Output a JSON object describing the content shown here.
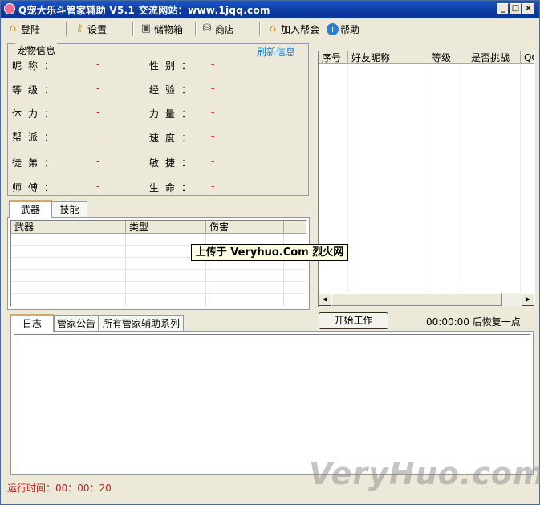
{
  "window": {
    "title": "Q宠大乐斗管家辅助 V5.1 交流网站：www.1jqq.com",
    "controls": [
      "_",
      "□",
      "×"
    ]
  },
  "toolbar": {
    "items": [
      {
        "label": "登陆",
        "icon": "house-icon"
      },
      {
        "label": "设置",
        "icon": "key-icon"
      },
      {
        "label": "储物箱",
        "icon": "box-icon"
      },
      {
        "label": "商店",
        "icon": "shop-icon"
      },
      {
        "label": "加入帮会",
        "icon": "house-icon"
      },
      {
        "label": "帮助",
        "icon": "help-icon"
      }
    ]
  },
  "pet_info": {
    "title": "宠物信息",
    "refresh_label": "刷新信息",
    "left": [
      {
        "label": "昵称：",
        "value": "-"
      },
      {
        "label": "等级：",
        "value": "-"
      },
      {
        "label": "体力：",
        "value": "-"
      },
      {
        "label": "帮派：",
        "value": "-"
      },
      {
        "label": "徒弟：",
        "value": "-"
      },
      {
        "label": "师傅：",
        "value": "-"
      }
    ],
    "right": [
      {
        "label": "性别：",
        "value": "-"
      },
      {
        "label": "经验：",
        "value": "-"
      },
      {
        "label": "力量：",
        "value": "-"
      },
      {
        "label": "速度：",
        "value": "-"
      },
      {
        "label": "敏捷：",
        "value": "-"
      },
      {
        "label": "生命：",
        "value": "-"
      }
    ]
  },
  "equip_tabs": [
    "武器",
    "技能"
  ],
  "weapon_table": {
    "columns": [
      "武器",
      "类型",
      "伤害"
    ]
  },
  "friend_table": {
    "columns": [
      "序号",
      "好友昵称",
      "等级",
      "是否挑战",
      "QQ"
    ]
  },
  "watermark_label": "上传于 Veryhuo.Com 烈火网",
  "log_tabs": [
    "日志",
    "管家公告",
    "所有管家辅助系列"
  ],
  "start_button": "开始工作",
  "recover_text": "00:00:00 后恢复一点",
  "runtime_text": "运行时间：00：00：20",
  "watermark_logo": "VeryHuo.com"
}
